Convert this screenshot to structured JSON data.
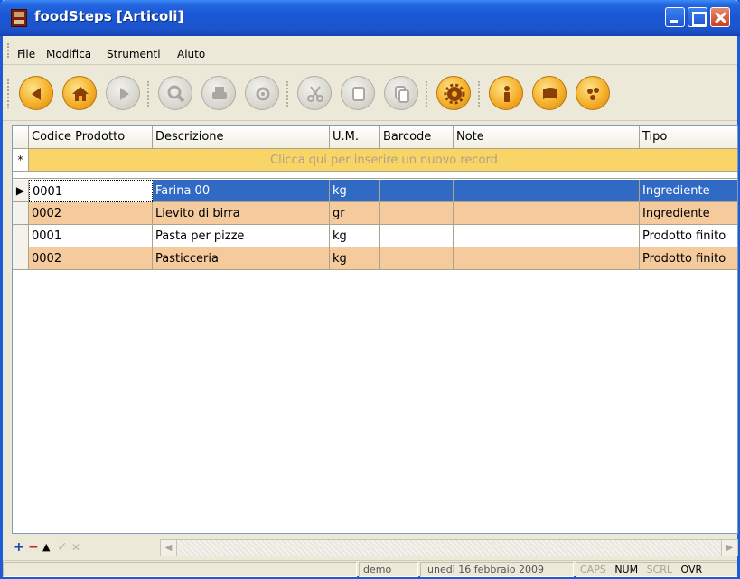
{
  "window": {
    "title": "foodSteps [Articoli]"
  },
  "menu": {
    "items": [
      {
        "label": "File",
        "underline": "F"
      },
      {
        "label": "Modifica",
        "underline": "M"
      },
      {
        "label": "Strumenti",
        "underline": "S"
      },
      {
        "label": "Aiuto",
        "underline": "A"
      }
    ]
  },
  "toolbar": {
    "buttons": [
      {
        "icon": "back-arrow-icon",
        "enabled": true
      },
      {
        "icon": "home-icon",
        "enabled": true
      },
      {
        "icon": "forward-arrow-icon",
        "enabled": false
      },
      {
        "icon": "search-icon",
        "enabled": false
      },
      {
        "icon": "print-icon",
        "enabled": false
      },
      {
        "icon": "preview-icon",
        "enabled": false
      },
      {
        "icon": "cut-icon",
        "enabled": false
      },
      {
        "icon": "copy-icon",
        "enabled": false
      },
      {
        "icon": "paste-icon",
        "enabled": false
      },
      {
        "icon": "settings-gear-icon",
        "enabled": true
      },
      {
        "icon": "info-icon",
        "enabled": true
      },
      {
        "icon": "book-icon",
        "enabled": true
      },
      {
        "icon": "palette-icon",
        "enabled": true
      }
    ]
  },
  "grid": {
    "columns": [
      "Codice Prodotto",
      "Descrizione",
      "U.M.",
      "Barcode",
      "Note",
      "Tipo"
    ],
    "new_row_marker": "*",
    "new_row_prompt": "Clicca qui per inserire un nuovo record",
    "current_row_marker": "▶",
    "rows": [
      {
        "codice": "0001",
        "descrizione": "Farina 00",
        "um": "kg",
        "barcode": "",
        "note": "",
        "tipo": "Ingrediente"
      },
      {
        "codice": "0002",
        "descrizione": "Lievito di birra",
        "um": "gr",
        "barcode": "",
        "note": "",
        "tipo": "Ingrediente"
      },
      {
        "codice": "0001",
        "descrizione": "Pasta per pizze",
        "um": "kg",
        "barcode": "",
        "note": "",
        "tipo": "Prodotto finito"
      },
      {
        "codice": "0002",
        "descrizione": "Pasticceria",
        "um": "kg",
        "barcode": "",
        "note": "",
        "tipo": "Prodotto finito"
      }
    ]
  },
  "navigator": {
    "add": "+",
    "remove": "−",
    "up": "▲",
    "confirm": "✓",
    "cancel": "✕"
  },
  "statusbar": {
    "user": "demo",
    "date": "lunedì 16 febbraio 2009",
    "caps": "CAPS",
    "num": "NUM",
    "scrl": "SCRL",
    "ovr": "OVR"
  },
  "colors": {
    "title_bar": "#1a56d4",
    "selected_row": "#316ac5",
    "alt_row": "#f5ca9c",
    "new_row": "#f8d566",
    "toolbar_active": "#f5b02b"
  }
}
